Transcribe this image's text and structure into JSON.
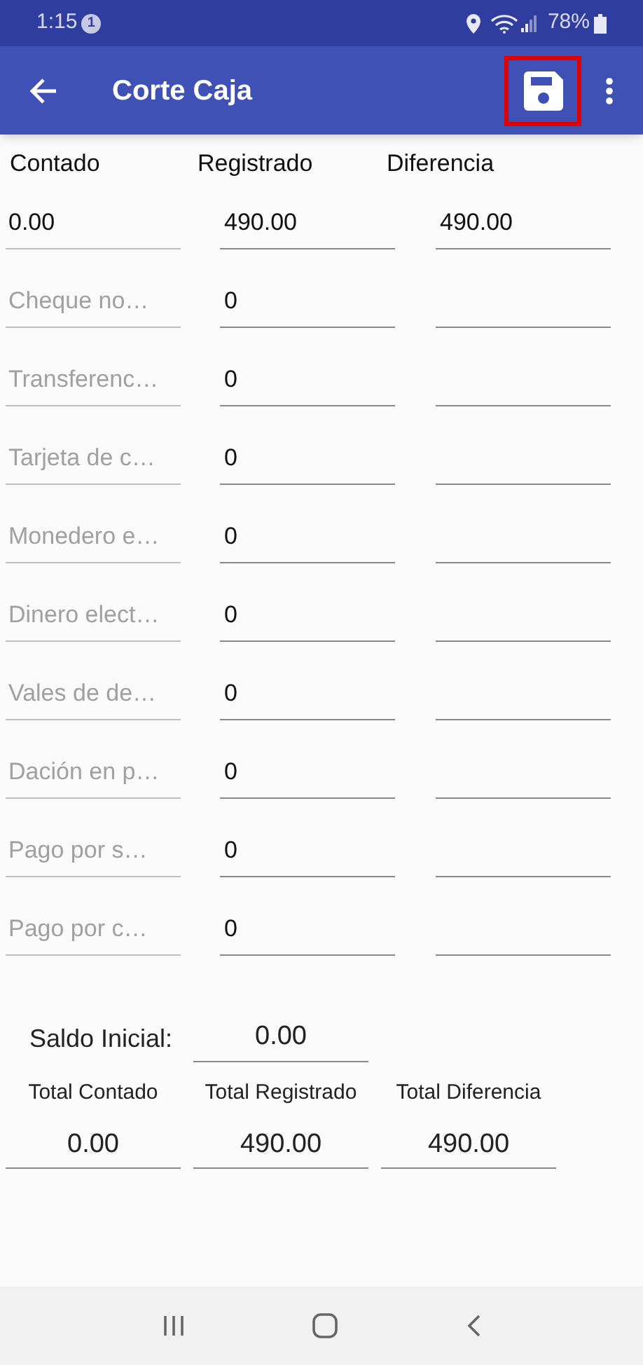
{
  "status_bar": {
    "time": "1:15",
    "notification_count": "1",
    "battery": "78%"
  },
  "app_bar": {
    "title": "Corte Caja",
    "save_highlighted": true
  },
  "columns": [
    "Contado",
    "Registrado",
    "Diferencia"
  ],
  "rows": [
    {
      "contado": {
        "value": "0.00"
      },
      "registrado": "490.00",
      "diferencia": "490.00"
    },
    {
      "contado": {
        "placeholder": "Cheque no…"
      },
      "registrado": "0"
    },
    {
      "contado": {
        "placeholder": "Transferenc…"
      },
      "registrado": "0"
    },
    {
      "contado": {
        "placeholder": "Tarjeta de c…"
      },
      "registrado": "0"
    },
    {
      "contado": {
        "placeholder": "Monedero e…"
      },
      "registrado": "0"
    },
    {
      "contado": {
        "placeholder": "Dinero elect…"
      },
      "registrado": "0"
    },
    {
      "contado": {
        "placeholder": "Vales de de…"
      },
      "registrado": "0"
    },
    {
      "contado": {
        "placeholder": "Dación en p…"
      },
      "registrado": "0"
    },
    {
      "contado": {
        "placeholder": "Pago por s…"
      },
      "registrado": "0"
    },
    {
      "contado": {
        "placeholder": "Pago por c…"
      },
      "registrado": "0"
    }
  ],
  "saldo_inicial": {
    "label": "Saldo Inicial:",
    "value": "0.00"
  },
  "totals": [
    {
      "label": "Total Contado",
      "value": "0.00"
    },
    {
      "label": "Total Registrado",
      "value": "490.00"
    },
    {
      "label": "Total Diferencia",
      "value": "490.00"
    }
  ]
}
